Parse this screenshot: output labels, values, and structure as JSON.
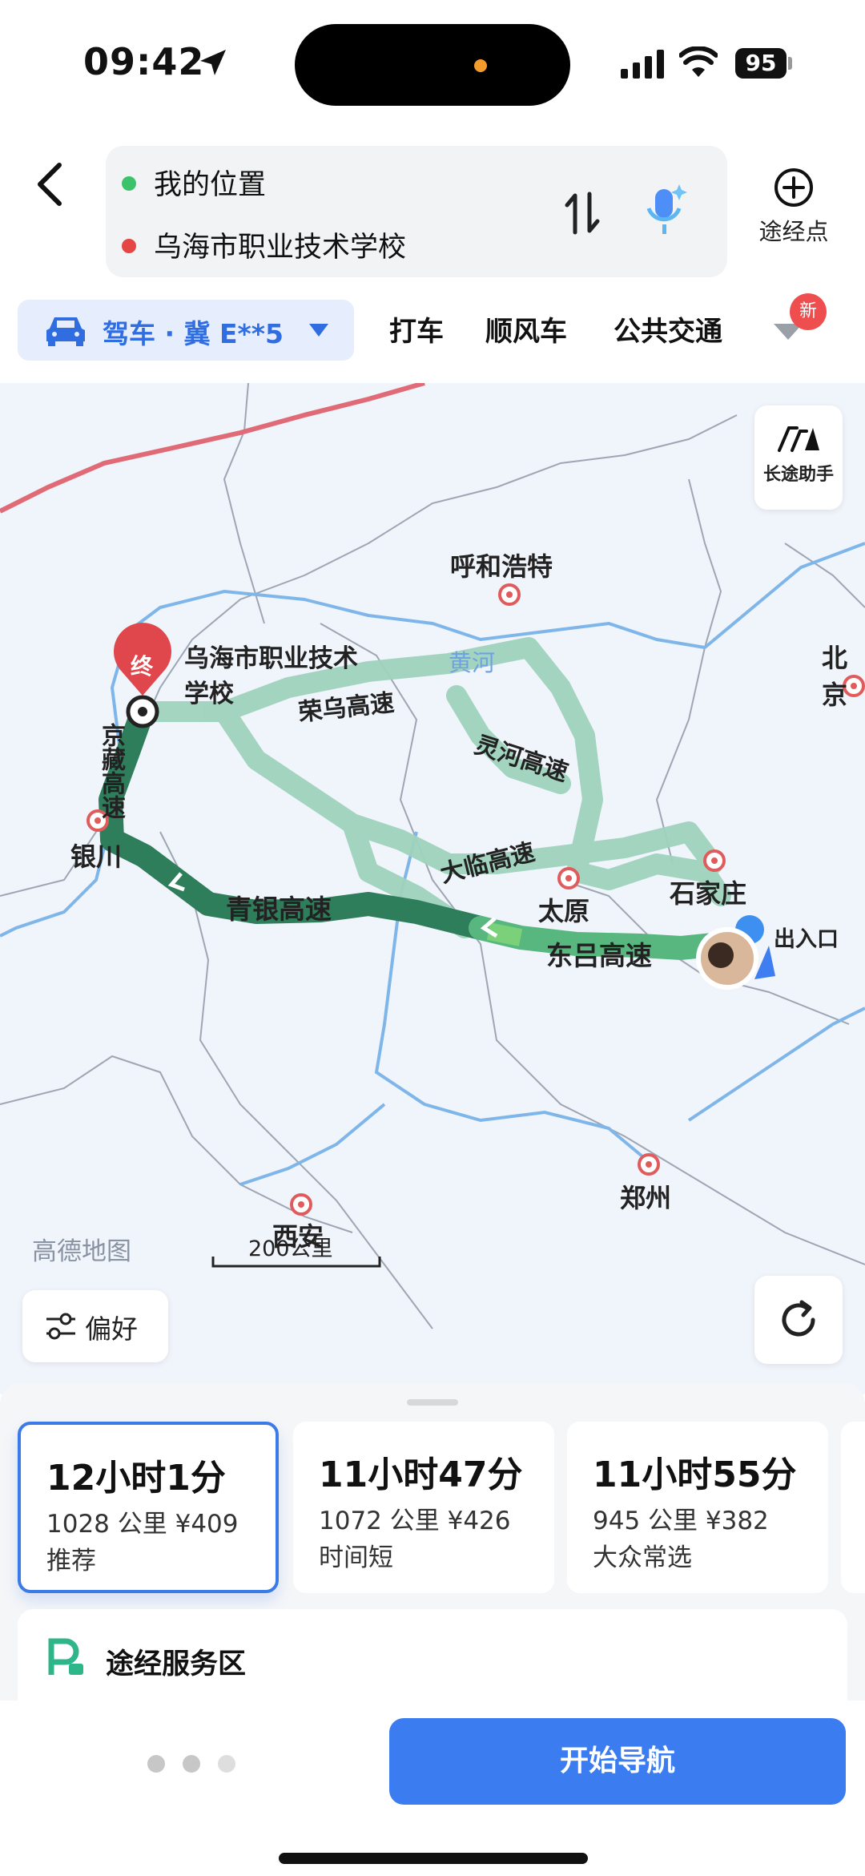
{
  "status_bar": {
    "time": "09:42",
    "battery": "95"
  },
  "header": {
    "origin": "我的位置",
    "destination": "乌海市职业技术学校",
    "waypoint_label": "途经点"
  },
  "modes": {
    "selected_label": "驾车 · 冀 E**5",
    "tabs": [
      "打车",
      "顺风车",
      "公共交通"
    ],
    "badge": "新"
  },
  "map": {
    "assist_label": "长途助手",
    "dest_marker": "终",
    "dest_name": "乌海市职业技术学校",
    "cities": [
      "呼和浩特",
      "北京",
      "银川",
      "太原",
      "石家庄",
      "郑州",
      "西安"
    ],
    "river": "黄河",
    "highways": [
      "荣乌高速",
      "灵河高速",
      "京藏高速",
      "大临高速",
      "青银高速",
      "东吕高速"
    ],
    "exit_label": "出入口",
    "brand": "高德地图",
    "scale": "200公里",
    "pref_label": "偏好"
  },
  "routes": [
    {
      "time": "12小时1分",
      "distance": "1028 公里",
      "cost": "¥409",
      "tag": "推荐",
      "selected": true
    },
    {
      "time": "11小时47分",
      "distance": "1072 公里",
      "cost": "¥426",
      "tag": "时间短",
      "selected": false
    },
    {
      "time": "11小时55分",
      "distance": "945 公里",
      "cost": "¥382",
      "tag": "大众常选",
      "selected": false
    }
  ],
  "service": {
    "label": "途经服务区"
  },
  "footer": {
    "start_label": "开始导航"
  },
  "colors": {
    "accent": "#3b7cf0",
    "route_main": "#2e7d5b",
    "route_alt": "#9fd3bd"
  }
}
